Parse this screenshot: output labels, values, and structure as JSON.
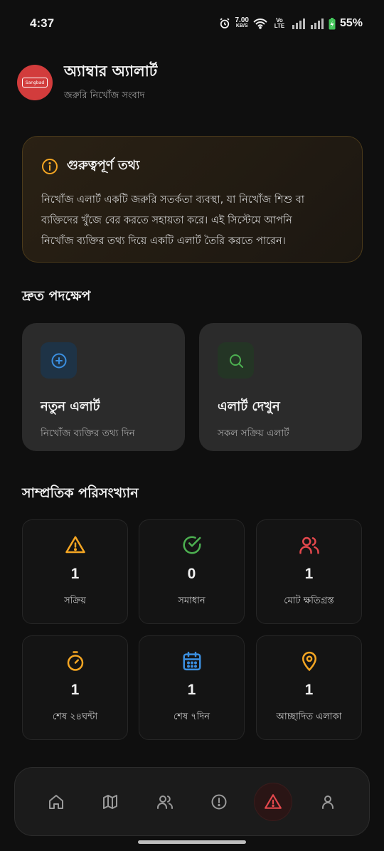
{
  "status": {
    "time": "4:37",
    "speed_top": "7.00",
    "speed_unit": "KB/S",
    "network": "Vo LTE",
    "battery": "55%"
  },
  "header": {
    "title": "অ্যাম্বার অ্যালার্ট",
    "subtitle": "জরুরি নিখোঁজ সংবাদ",
    "logo_text": "Sangbad"
  },
  "info": {
    "title": "গুরুত্বপূর্ণ তথ্য",
    "lines": [
      "নিখোঁজ এলার্ট একটি জরুরি সতর্কতা ব্যবস্থা, যা নিখোঁজ শিশু বা",
      "ব্যক্তিদের খুঁজে বের করতে সহায়তা করে। এই সিস্টেমে আপনি",
      "নিখোঁজ ব্যক্তির তথ্য দিয়ে একটি এলার্ট তৈরি করতে পারেন।"
    ]
  },
  "quick_actions": {
    "title": "দ্রুত পদক্ষেপ",
    "new_alert": {
      "title": "নতুন এলার্ট",
      "sub": "নিখোঁজ ব্যক্তির তথ্য দিন"
    },
    "view_alerts": {
      "title": "এলার্ট দেখুন",
      "sub": "সকল সক্রিয় এলার্ট"
    }
  },
  "stats": {
    "title": "সাম্প্রতিক পরিসংখ্যান",
    "items": [
      {
        "value": "1",
        "label": "সক্রিয়",
        "icon": "warning-triangle-icon",
        "color": "#f5a623"
      },
      {
        "value": "0",
        "label": "সমাধান",
        "icon": "check-circle-icon",
        "color": "#4caf50"
      },
      {
        "value": "1",
        "label": "মোট ক্ষতিগ্রস্ত",
        "icon": "users-icon",
        "color": "#e5484d"
      },
      {
        "value": "1",
        "label": "শেষ ২৪ঘন্টা",
        "icon": "timer-icon",
        "color": "#f5a623"
      },
      {
        "value": "1",
        "label": "শেষ ৭দিন",
        "icon": "calendar-icon",
        "color": "#3b8fe0"
      },
      {
        "value": "1",
        "label": "আচ্ছাদিত এলাকা",
        "icon": "location-pin-icon",
        "color": "#f5a623"
      }
    ]
  },
  "nav": [
    "home-icon",
    "map-icon",
    "users-icon",
    "alert-circle-icon",
    "warning-triangle-icon",
    "user-icon"
  ],
  "colors": {
    "accent_red": "#e5484d",
    "accent_orange": "#f5a623",
    "accent_green": "#4caf50",
    "accent_blue": "#3b8fe0"
  }
}
